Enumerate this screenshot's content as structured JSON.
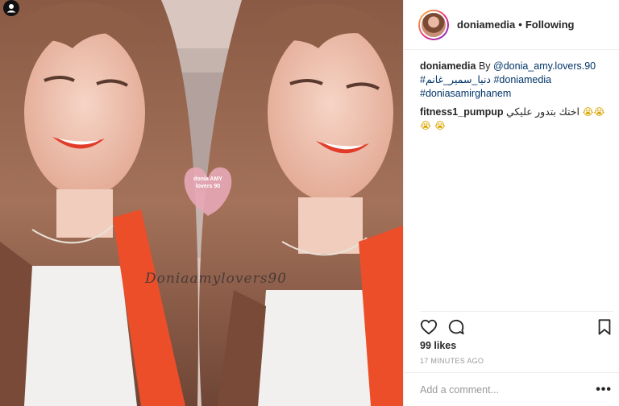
{
  "post": {
    "photo_watermark": "Doniaamylovers90",
    "sticker_text": "donia AMY lovers 90"
  },
  "header": {
    "username": "doniamedia",
    "separator": "•",
    "follow_status": "Following"
  },
  "caption": {
    "username": "doniamedia",
    "text_prefix": "By",
    "mention": "@donia_amy.lovers.90",
    "hashtags": [
      "#دنيا_سمير_غانم",
      "#doniamedia",
      "#doniasamirghanem"
    ]
  },
  "comments": [
    {
      "username": "fitness1_pumpup",
      "text": "اختك بتدور عليكي",
      "emoji": "😭😭😭 😭"
    }
  ],
  "actions": {
    "like_icon": "heart-icon",
    "comment_icon": "comment-bubble-icon",
    "save_icon": "bookmark-icon"
  },
  "likes": "99 likes",
  "timestamp": "17 MINUTES AGO",
  "add_comment": {
    "placeholder": "Add a comment...",
    "more_label": "•••"
  },
  "colors": {
    "link": "#003569",
    "text": "#262626",
    "muted": "#999999",
    "border": "#efefef"
  }
}
